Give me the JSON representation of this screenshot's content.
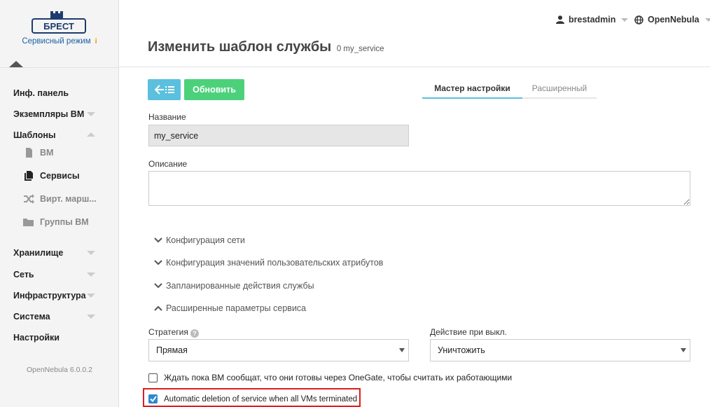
{
  "sidebar": {
    "logo_text": "БРЕСТ",
    "mode_label": "Сервисный режим",
    "mode_info": "i",
    "items": [
      {
        "label": "Инф. панель"
      },
      {
        "label": "Экземпляры ВМ"
      },
      {
        "label": "Шаблоны"
      },
      {
        "label": "Хранилище"
      },
      {
        "label": "Сеть"
      },
      {
        "label": "Инфраструктура"
      },
      {
        "label": "Система"
      },
      {
        "label": "Настройки"
      }
    ],
    "sub_items": [
      {
        "label": "ВМ",
        "icon": "file-icon"
      },
      {
        "label": "Сервисы",
        "icon": "files-icon"
      },
      {
        "label": "Вирт. марш...",
        "icon": "shuffle-icon"
      },
      {
        "label": "Группы ВМ",
        "icon": "folder-icon"
      }
    ],
    "version": "OpenNebula 6.0.0.2"
  },
  "header": {
    "user": "brestadmin",
    "zone": "OpenNebula"
  },
  "page": {
    "title": "Изменить шаблон службы",
    "subtitle": "0 my_service"
  },
  "toolbar": {
    "update_label": "Обновить"
  },
  "tabs": {
    "wizard": "Мастер настройки",
    "advanced": "Расширенный"
  },
  "form": {
    "name_label": "Название",
    "name_value": "my_service",
    "description_label": "Описание",
    "description_value": "",
    "sections": [
      {
        "label": "Конфигурация сети",
        "expanded": false
      },
      {
        "label": "Конфигурация значений пользовательских атрибутов",
        "expanded": false
      },
      {
        "label": "Запланированные действия службы",
        "expanded": false
      },
      {
        "label": "Расширенные параметры сервиса",
        "expanded": true
      }
    ],
    "strategy_label": "Стратегия",
    "strategy_value": "Прямая",
    "shutdown_label": "Действие при выкл.",
    "shutdown_value": "Уничтожить",
    "wait_ready_label": "Ждать пока ВМ сообщат, что они готовы через OneGate, чтобы считать их работающими",
    "wait_ready_checked": false,
    "auto_delete_label": "Automatic deletion of service when all VMs terminated",
    "auto_delete_checked": true
  },
  "colors": {
    "back_button": "#5bc0de",
    "update_button": "#4cd17a",
    "highlight": "#e01b1b",
    "checkbox": "#2b8ad0"
  }
}
